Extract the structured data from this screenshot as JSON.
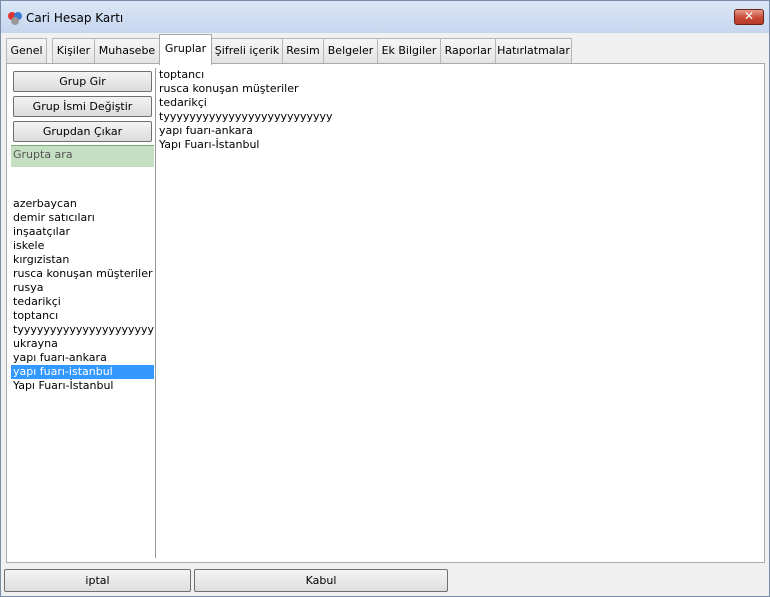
{
  "window": {
    "title": "Cari Hesap Kartı"
  },
  "tabs": [
    {
      "label": "Genel"
    },
    {
      "label": "Kişiler"
    },
    {
      "label": "Muhasebe"
    },
    {
      "label": "Gruplar"
    },
    {
      "label": "Şifreli içerik"
    },
    {
      "label": "Resim"
    },
    {
      "label": "Belgeler"
    },
    {
      "label": "Ek Bilgiler"
    },
    {
      "label": "Raporlar"
    },
    {
      "label": "Hatırlatmalar"
    }
  ],
  "active_tab": "Gruplar",
  "left": {
    "buttons": {
      "add": "Grup Gir",
      "rename": "Grup İsmi Değiştir",
      "remove": "Grupdan Çıkar"
    },
    "search_placeholder": "Grupta ara",
    "groups": [
      "azerbaycan",
      "demir satıcıları",
      "inşaatçılar",
      "iskele",
      "kırgızistan",
      "rusca konuşan müşteriler",
      "rusya",
      "tedarikçi",
      "toptancı",
      "tyyyyyyyyyyyyyyyyyyyyyyyyy",
      "ukrayna",
      "yapı fuarı-ankara",
      "yapı fuarı-istanbul",
      "Yapı Fuarı-İstanbul"
    ],
    "selected_group": "yapı fuarı-istanbul"
  },
  "assigned_groups": [
    "toptancı",
    "rusca konuşan müşteriler",
    "tedarikçi",
    "tyyyyyyyyyyyyyyyyyyyyyyyyyy",
    "yapı fuarı-ankara",
    "Yapı Fuarı-İstanbul"
  ],
  "footer": {
    "cancel": "iptal",
    "accept": "Kabul"
  },
  "colors": {
    "selection": "#3399ff",
    "search_bg": "#c5dfc2",
    "close_button": "#c74a35"
  }
}
